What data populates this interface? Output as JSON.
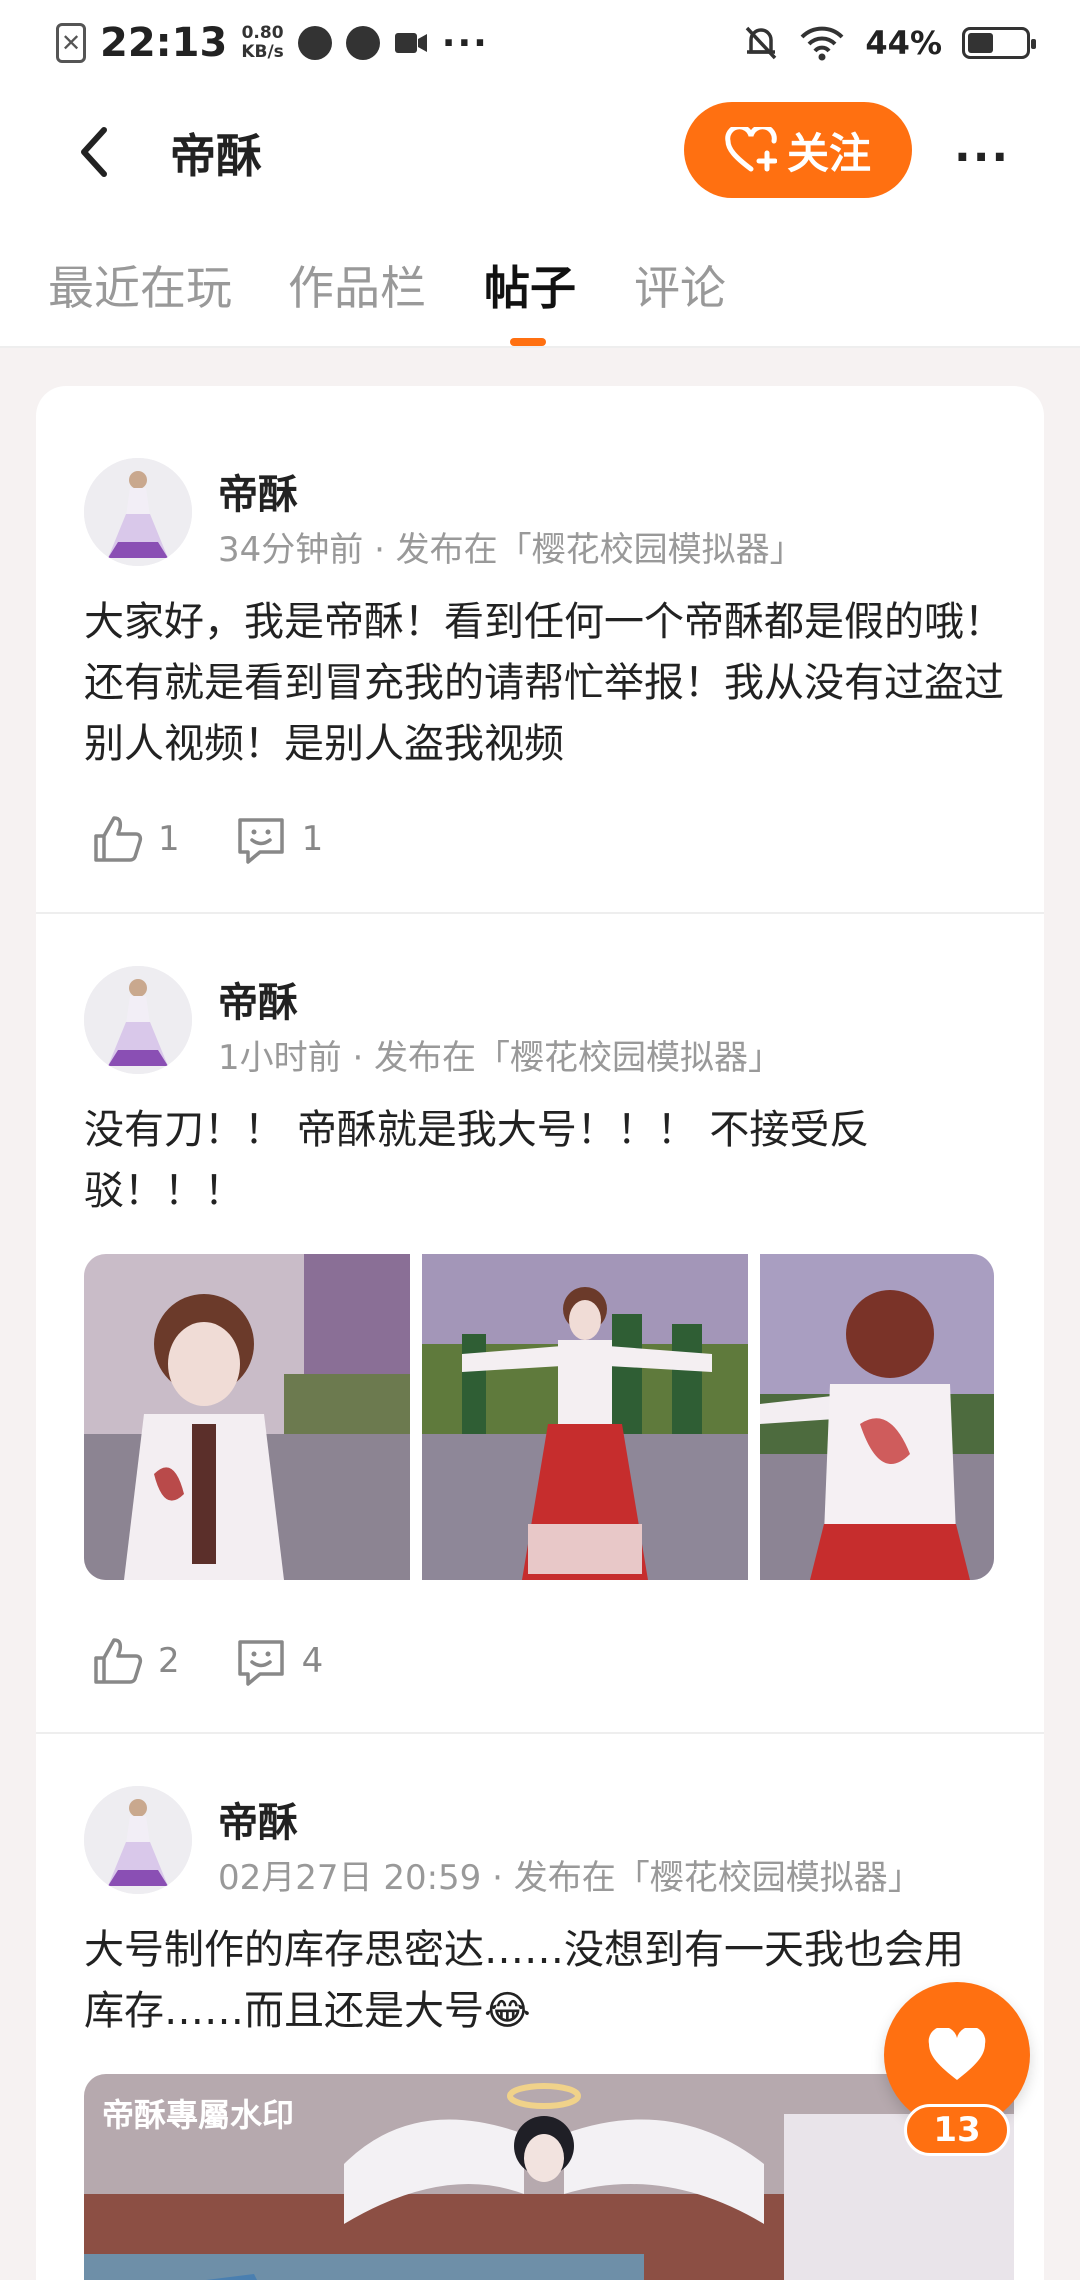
{
  "status_bar": {
    "time": "22:13",
    "speed_value": "0.80",
    "speed_unit": "KB/s",
    "more": "···",
    "battery": "44%",
    "battery_level": 0.44
  },
  "header": {
    "title": "帝酥",
    "follow_label": "关注",
    "more": "···"
  },
  "tabs": [
    {
      "label": "最近在玩"
    },
    {
      "label": "作品栏"
    },
    {
      "label": "帖子"
    },
    {
      "label": "评论"
    }
  ],
  "active_tab": "帖子",
  "posts": [
    {
      "author": "帝酥",
      "meta": "34分钟前 · 发布在「樱花校园模拟器」",
      "content": "大家好，我是帝酥！看到任何一个帝酥都是假的哦！还有就是看到冒充我的请帮忙举报！我从没有过盗过别人视频！是别人盗我视频",
      "likes": "1",
      "comments": "1"
    },
    {
      "author": "帝酥",
      "meta": "1小时前 · 发布在「樱花校园模拟器」",
      "content_line1": "没有刀！！ 帝酥就是我大号！！！ 不接受反",
      "content_line2": "驳！！！",
      "likes": "2",
      "comments": "4"
    },
    {
      "author": "帝酥",
      "meta": "02月27日 20:59 · 发布在「樱花校园模拟器」",
      "content": "大号制作的库存思密达……没想到有一天我也会用库存……而且还是大号😂",
      "watermark": "帝酥專屬水印"
    }
  ],
  "fab": {
    "count": "13"
  },
  "colors": {
    "accent": "#ff7011",
    "text": "#222222",
    "muted": "#999999"
  }
}
